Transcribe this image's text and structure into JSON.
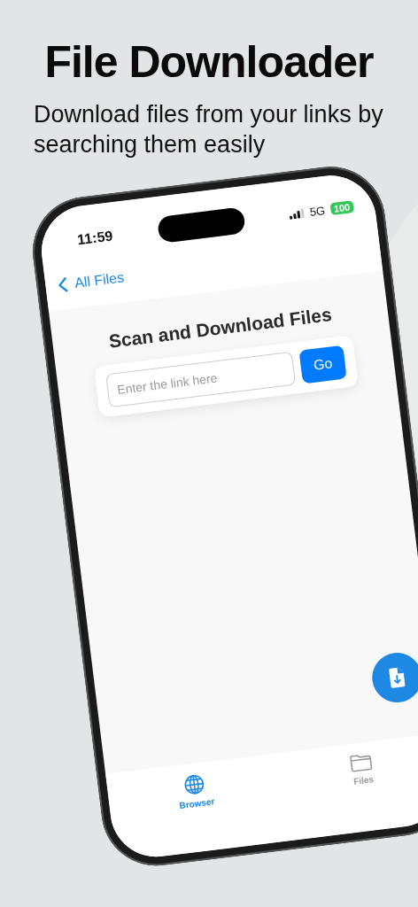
{
  "header": {
    "title": "File Downloader",
    "subtitle": "Download files from your links by searching them easily"
  },
  "status_bar": {
    "time": "11:59",
    "network": "5G",
    "battery": "100"
  },
  "nav": {
    "back_label": "All Files"
  },
  "content": {
    "title": "Scan and Download Files",
    "link_field": {
      "placeholder": "Enter the link here"
    },
    "go_button": "Go"
  },
  "tabs": [
    {
      "label": "Browser",
      "kind": "globe",
      "selected": true
    },
    {
      "label": "Files",
      "kind": "folder",
      "selected": false
    }
  ]
}
